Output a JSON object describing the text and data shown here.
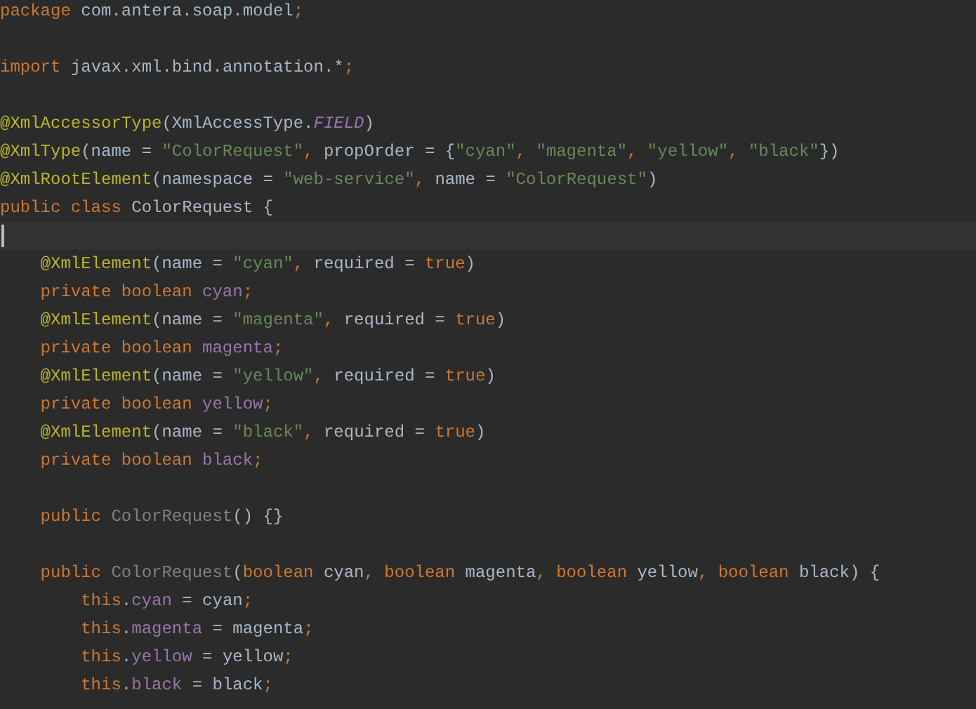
{
  "editor": {
    "lines": [
      {
        "kind": "code",
        "tokens": [
          {
            "text": "package",
            "kind": "kw"
          },
          {
            "text": " com.antera.soap.model",
            "kind": "plain"
          },
          {
            "text": ";",
            "kind": "kw"
          }
        ]
      },
      {
        "kind": "code"
      },
      {
        "kind": "code",
        "tokens": [
          {
            "text": "import",
            "kind": "kw"
          },
          {
            "text": " javax.xml.bind.annotation.*",
            "kind": "plain"
          },
          {
            "text": ";",
            "kind": "kw"
          }
        ]
      },
      {
        "kind": "code"
      },
      {
        "kind": "code",
        "tokens": [
          {
            "text": "@XmlAccessorType",
            "kind": "ann"
          },
          {
            "text": "(XmlAccessType.",
            "kind": "plain"
          },
          {
            "text": "FIELD",
            "kind": "const"
          },
          {
            "text": ")",
            "kind": "plain"
          }
        ]
      },
      {
        "kind": "code",
        "tokens": [
          {
            "text": "@XmlType",
            "kind": "ann"
          },
          {
            "text": "(name = ",
            "kind": "plain"
          },
          {
            "text": "\"ColorRequest\"",
            "kind": "str"
          },
          {
            "text": ", ",
            "kind": "kw"
          },
          {
            "text": "propOrder = {",
            "kind": "plain"
          },
          {
            "text": "\"cyan\"",
            "kind": "str"
          },
          {
            "text": ", ",
            "kind": "kw"
          },
          {
            "text": "\"magenta\"",
            "kind": "str"
          },
          {
            "text": ", ",
            "kind": "kw"
          },
          {
            "text": "\"yellow\"",
            "kind": "str"
          },
          {
            "text": ", ",
            "kind": "kw"
          },
          {
            "text": "\"black\"",
            "kind": "str"
          },
          {
            "text": "})",
            "kind": "plain"
          }
        ]
      },
      {
        "kind": "code",
        "tokens": [
          {
            "text": "@XmlRootElement",
            "kind": "ann"
          },
          {
            "text": "(namespace = ",
            "kind": "plain"
          },
          {
            "text": "\"web-service\"",
            "kind": "str"
          },
          {
            "text": ", ",
            "kind": "kw"
          },
          {
            "text": "name = ",
            "kind": "plain"
          },
          {
            "text": "\"ColorRequest\"",
            "kind": "str"
          },
          {
            "text": ")",
            "kind": "plain"
          }
        ]
      },
      {
        "kind": "code",
        "tokens": [
          {
            "text": "public class ",
            "kind": "kw"
          },
          {
            "text": "ColorRequest {",
            "kind": "plain"
          }
        ]
      },
      {
        "kind": "cursor"
      },
      {
        "kind": "code",
        "tokens": [
          {
            "text": "    @XmlElement",
            "kind": "ann"
          },
          {
            "text": "(name = ",
            "kind": "plain"
          },
          {
            "text": "\"cyan\"",
            "kind": "str"
          },
          {
            "text": ", ",
            "kind": "kw"
          },
          {
            "text": "required = ",
            "kind": "plain"
          },
          {
            "text": "true",
            "kind": "kw"
          },
          {
            "text": ")",
            "kind": "plain"
          }
        ]
      },
      {
        "kind": "code",
        "tokens": [
          {
            "text": "    private boolean ",
            "kind": "kw"
          },
          {
            "text": "cyan",
            "kind": "field"
          },
          {
            "text": ";",
            "kind": "kw"
          }
        ]
      },
      {
        "kind": "code",
        "tokens": [
          {
            "text": "    @XmlElement",
            "kind": "ann"
          },
          {
            "text": "(name = ",
            "kind": "plain"
          },
          {
            "text": "\"magenta\"",
            "kind": "str"
          },
          {
            "text": ", ",
            "kind": "kw"
          },
          {
            "text": "required = ",
            "kind": "plain"
          },
          {
            "text": "true",
            "kind": "kw"
          },
          {
            "text": ")",
            "kind": "plain"
          }
        ]
      },
      {
        "kind": "code",
        "tokens": [
          {
            "text": "    private boolean ",
            "kind": "kw"
          },
          {
            "text": "magenta",
            "kind": "field"
          },
          {
            "text": ";",
            "kind": "kw"
          }
        ]
      },
      {
        "kind": "code",
        "tokens": [
          {
            "text": "    @XmlElement",
            "kind": "ann"
          },
          {
            "text": "(name = ",
            "kind": "plain"
          },
          {
            "text": "\"yellow\"",
            "kind": "str"
          },
          {
            "text": ", ",
            "kind": "kw"
          },
          {
            "text": "required = ",
            "kind": "plain"
          },
          {
            "text": "true",
            "kind": "kw"
          },
          {
            "text": ")",
            "kind": "plain"
          }
        ]
      },
      {
        "kind": "code",
        "tokens": [
          {
            "text": "    private boolean ",
            "kind": "kw"
          },
          {
            "text": "yellow",
            "kind": "field"
          },
          {
            "text": ";",
            "kind": "kw"
          }
        ]
      },
      {
        "kind": "code",
        "tokens": [
          {
            "text": "    @XmlElement",
            "kind": "ann"
          },
          {
            "text": "(name = ",
            "kind": "plain"
          },
          {
            "text": "\"black\"",
            "kind": "str"
          },
          {
            "text": ", ",
            "kind": "kw"
          },
          {
            "text": "required = ",
            "kind": "plain"
          },
          {
            "text": "true",
            "kind": "kw"
          },
          {
            "text": ")",
            "kind": "plain"
          }
        ]
      },
      {
        "kind": "code",
        "tokens": [
          {
            "text": "    private boolean ",
            "kind": "kw"
          },
          {
            "text": "black",
            "kind": "field"
          },
          {
            "text": ";",
            "kind": "kw"
          }
        ]
      },
      {
        "kind": "code"
      },
      {
        "kind": "code",
        "tokens": [
          {
            "text": "    public ",
            "kind": "kw"
          },
          {
            "text": "ColorRequest",
            "kind": "unused"
          },
          {
            "text": "() {}",
            "kind": "plain"
          }
        ]
      },
      {
        "kind": "code"
      },
      {
        "kind": "code",
        "tokens": [
          {
            "text": "    public ",
            "kind": "kw"
          },
          {
            "text": "ColorRequest",
            "kind": "unused"
          },
          {
            "text": "(",
            "kind": "plain"
          },
          {
            "text": "boolean ",
            "kind": "kw"
          },
          {
            "text": "cyan",
            "kind": "plain"
          },
          {
            "text": ", boolean ",
            "kind": "kw"
          },
          {
            "text": "magenta",
            "kind": "plain"
          },
          {
            "text": ", boolean ",
            "kind": "kw"
          },
          {
            "text": "yellow",
            "kind": "plain"
          },
          {
            "text": ", boolean ",
            "kind": "kw"
          },
          {
            "text": "black) {",
            "kind": "plain"
          }
        ]
      },
      {
        "kind": "code",
        "tokens": [
          {
            "text": "        this",
            "kind": "kw"
          },
          {
            "text": ".",
            "kind": "plain"
          },
          {
            "text": "cyan",
            "kind": "field"
          },
          {
            "text": " = cyan",
            "kind": "plain"
          },
          {
            "text": ";",
            "kind": "kw"
          }
        ]
      },
      {
        "kind": "code",
        "tokens": [
          {
            "text": "        this",
            "kind": "kw"
          },
          {
            "text": ".",
            "kind": "plain"
          },
          {
            "text": "magenta",
            "kind": "field"
          },
          {
            "text": " = magenta",
            "kind": "plain"
          },
          {
            "text": ";",
            "kind": "kw"
          }
        ]
      },
      {
        "kind": "code",
        "tokens": [
          {
            "text": "        this",
            "kind": "kw"
          },
          {
            "text": ".",
            "kind": "plain"
          },
          {
            "text": "yellow",
            "kind": "field"
          },
          {
            "text": " = yellow",
            "kind": "plain"
          },
          {
            "text": ";",
            "kind": "kw"
          }
        ]
      },
      {
        "kind": "code",
        "tokens": [
          {
            "text": "        this",
            "kind": "kw"
          },
          {
            "text": ".",
            "kind": "plain"
          },
          {
            "text": "black",
            "kind": "field"
          },
          {
            "text": " = black",
            "kind": "plain"
          },
          {
            "text": ";",
            "kind": "kw"
          }
        ]
      }
    ]
  }
}
